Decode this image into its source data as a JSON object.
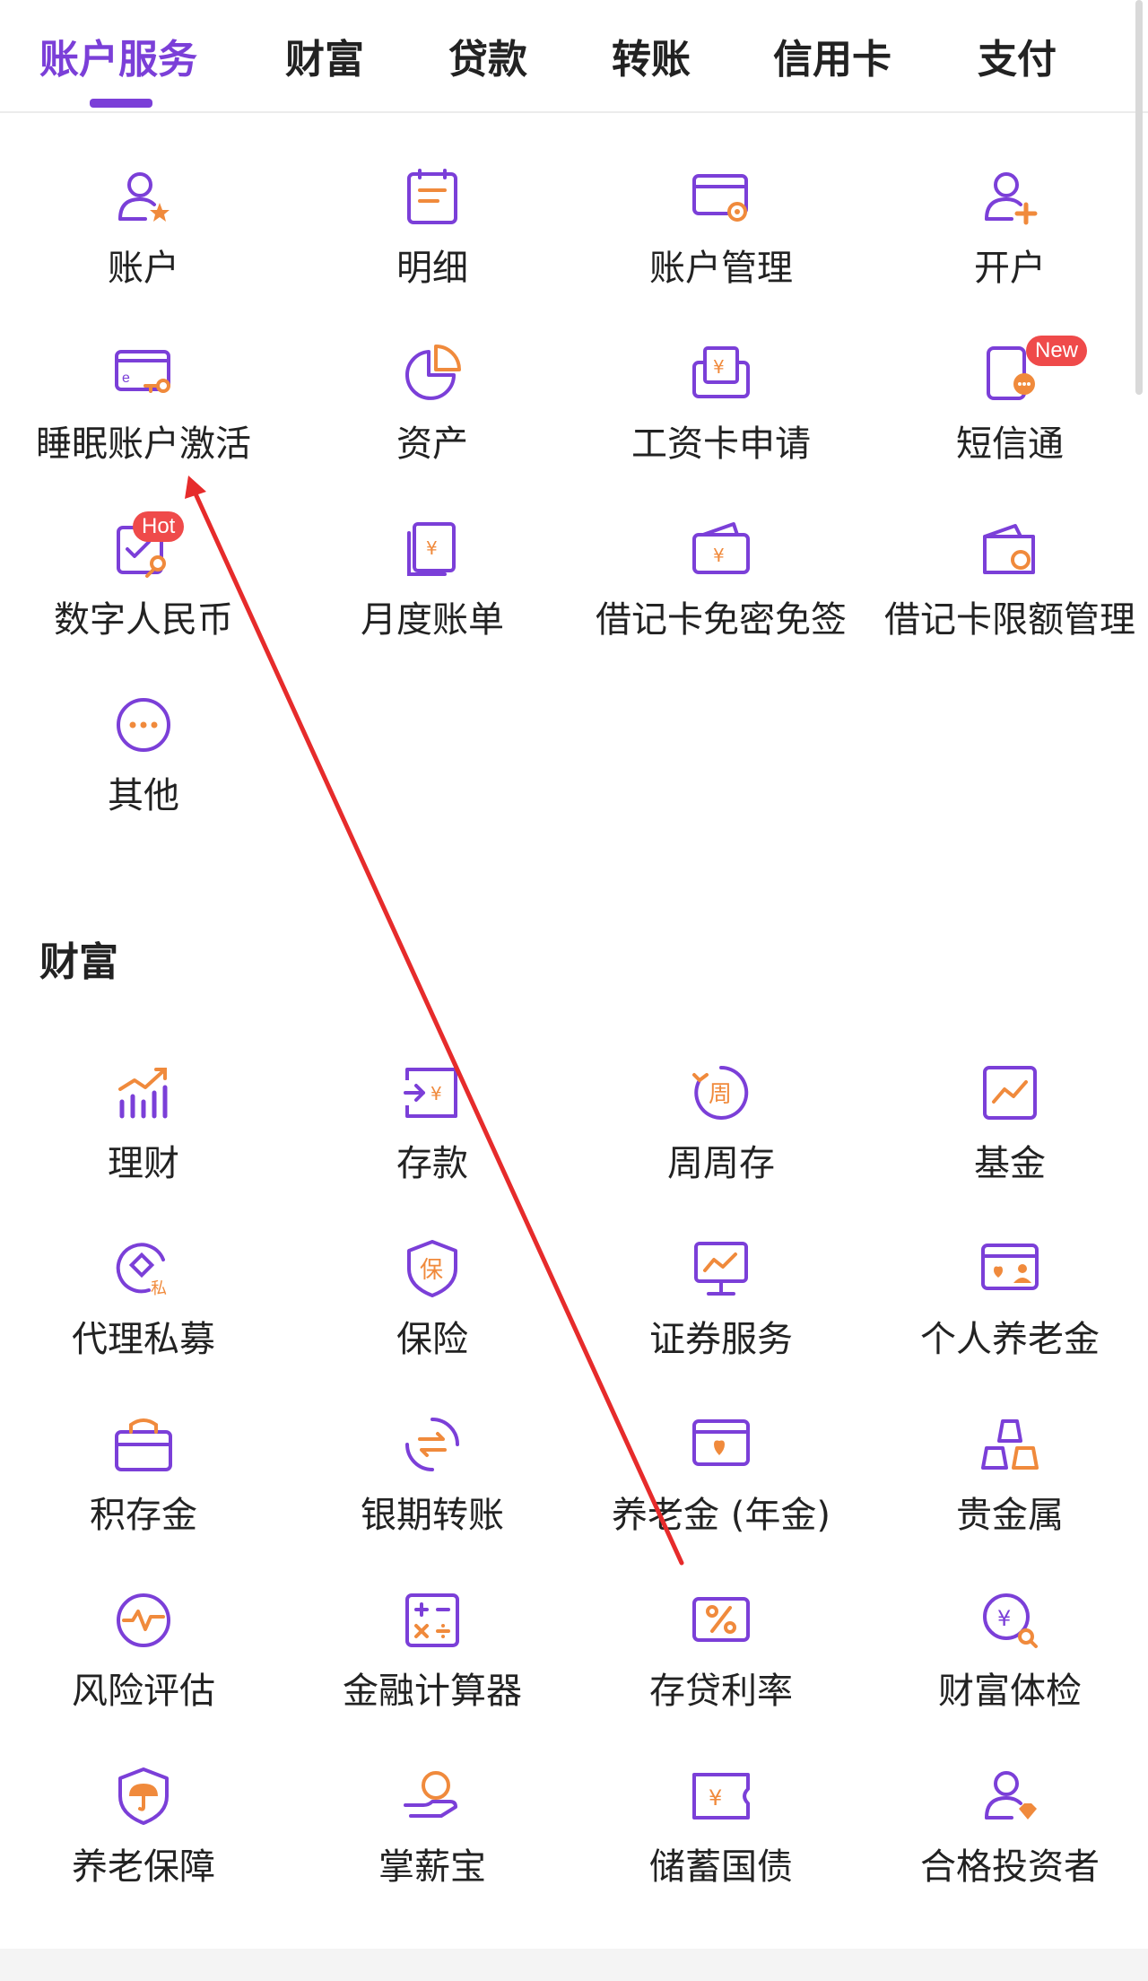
{
  "tabs": [
    {
      "label": "账户服务",
      "active": true
    },
    {
      "label": "财富"
    },
    {
      "label": "贷款"
    },
    {
      "label": "转账"
    },
    {
      "label": "信用卡"
    },
    {
      "label": "支付"
    }
  ],
  "account_items": [
    {
      "label": "账户",
      "icon": "user-star-icon"
    },
    {
      "label": "明细",
      "icon": "document-list-icon"
    },
    {
      "label": "账户管理",
      "icon": "card-gear-icon"
    },
    {
      "label": "开户",
      "icon": "user-add-icon"
    },
    {
      "label": "睡眠账户激活",
      "icon": "card-key-icon"
    },
    {
      "label": "资产",
      "icon": "pie-chart-icon"
    },
    {
      "label": "工资卡申请",
      "icon": "salary-card-icon"
    },
    {
      "label": "短信通",
      "icon": "phone-message-icon",
      "badge": "New"
    },
    {
      "label": "数字人民币",
      "icon": "digital-rmb-icon",
      "badge": "Hot"
    },
    {
      "label": "月度账单",
      "icon": "monthly-bill-icon"
    },
    {
      "label": "借记卡免密免签",
      "icon": "card-yuan-icon"
    },
    {
      "label": "借记卡限额管理",
      "icon": "wallet-limit-icon"
    },
    {
      "label": "其他",
      "icon": "more-icon"
    }
  ],
  "wealth_title": "财富",
  "wealth_items": [
    {
      "label": "理财",
      "icon": "bar-growth-icon"
    },
    {
      "label": "存款",
      "icon": "deposit-icon"
    },
    {
      "label": "周周存",
      "icon": "weekly-deposit-icon"
    },
    {
      "label": "基金",
      "icon": "fund-chart-icon"
    },
    {
      "label": "代理私募",
      "icon": "private-fund-icon"
    },
    {
      "label": "保险",
      "icon": "insurance-shield-icon"
    },
    {
      "label": "证券服务",
      "icon": "securities-monitor-icon"
    },
    {
      "label": "个人养老金",
      "icon": "pension-card-icon"
    },
    {
      "label": "积存金",
      "icon": "gold-bag-icon"
    },
    {
      "label": "银期转账",
      "icon": "exchange-icon"
    },
    {
      "label": "养老金 (年金)",
      "icon": "heart-card-icon"
    },
    {
      "label": "贵金属",
      "icon": "gold-bars-icon"
    },
    {
      "label": "风险评估",
      "icon": "risk-wave-icon"
    },
    {
      "label": "金融计算器",
      "icon": "calculator-icon"
    },
    {
      "label": "存贷利率",
      "icon": "percent-card-icon"
    },
    {
      "label": "财富体检",
      "icon": "wealth-check-icon"
    },
    {
      "label": "养老保障",
      "icon": "umbrella-shield-icon"
    },
    {
      "label": "掌薪宝",
      "icon": "hand-coin-icon"
    },
    {
      "label": "储蓄国债",
      "icon": "bond-ticket-icon"
    },
    {
      "label": "合格投资者",
      "icon": "qualified-investor-icon"
    }
  ],
  "colors": {
    "accent": "#7b3fd8",
    "secondary": "#f08a3c",
    "badge": "#ef4a4a",
    "arrow": "#e62b2b"
  }
}
